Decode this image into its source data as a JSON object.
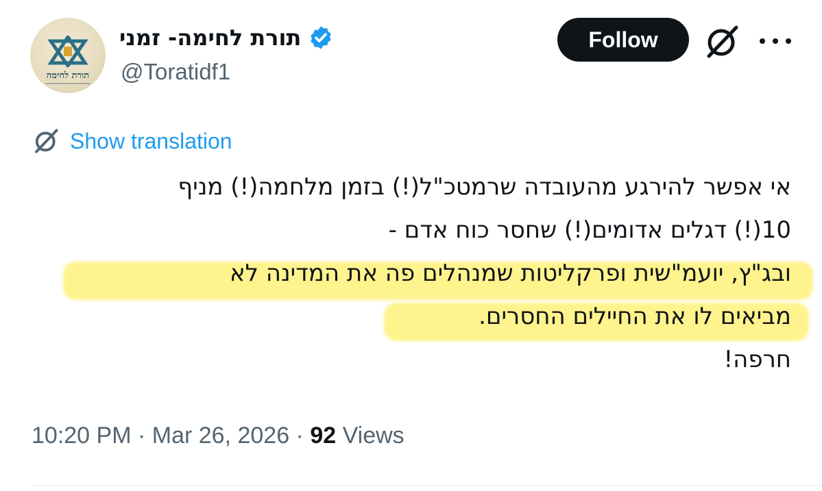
{
  "author": {
    "display_name": "תורת לחימה- זמני",
    "handle": "@Toratidf1",
    "avatar_text": "תורת לחימה",
    "verified": true
  },
  "actions": {
    "follow_label": "Follow"
  },
  "translation": {
    "link_label": "Show translation"
  },
  "tweet": {
    "lines": [
      "אי אפשר להירגע מהעובדה שרמטכ\"ל(!) בזמן מלחמה(!) מניף",
      "10(!) דגלים אדומים(!) שחסר כוח אדם -",
      "ובג\"ץ, יועמ\"שית ופרקליטות שמנהלים פה את המדינה לא",
      "מביאים לו את החיילים החסרים.",
      "חרפה!"
    ]
  },
  "meta": {
    "time": "10:20 PM",
    "separator": " · ",
    "date": "Mar 26, 2026",
    "views_count": "92",
    "views_label": " Views"
  },
  "colors": {
    "follow_bg": "#0f1419",
    "link": "#1d9bf0",
    "verified": "#1d9bf0",
    "highlight": "#fff27a",
    "secondary_text": "#536471"
  }
}
